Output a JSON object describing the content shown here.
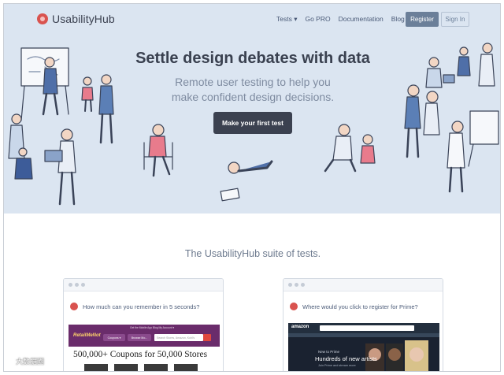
{
  "nav": {
    "logo_text": "UsabilityHub",
    "links": [
      "Tests ▾",
      "Go PRO",
      "Documentation",
      "Blog"
    ],
    "register_label": "Register",
    "signin_label": "Sign In"
  },
  "hero": {
    "title": "Settle design debates with data",
    "subtitle_line1": "Remote user testing to help you",
    "subtitle_line2": "make confident design decisions.",
    "cta_label": "Make your first test"
  },
  "suite": {
    "title": "The UsabilityHub suite of tests."
  },
  "cards": [
    {
      "question": "How much can you remember in 5 seconds?",
      "site": {
        "logo": "RetailMeNot",
        "topnav": "Get the Mobile App   Blog   My Account ▾",
        "pill1": "Coupons ▾",
        "pill2": "Browse Mo...",
        "search_placeholder": "Search Stores, Amazon, Kohl's",
        "headline": "500,000+ Coupons for 50,000 Stores"
      }
    },
    {
      "question": "Where would you click to register for Prime?",
      "site": {
        "logo": "amazon",
        "copy1": "New to Prime",
        "copy2": "Hundreds of new artists",
        "copy3": "Join Prime and stream more"
      }
    }
  ],
  "watermark": "大数据圈",
  "colors": {
    "hero_bg": "#dbe5f1",
    "accent_red": "#d9534f",
    "dark_button": "#3b4150",
    "register_button": "#6b7f99"
  }
}
